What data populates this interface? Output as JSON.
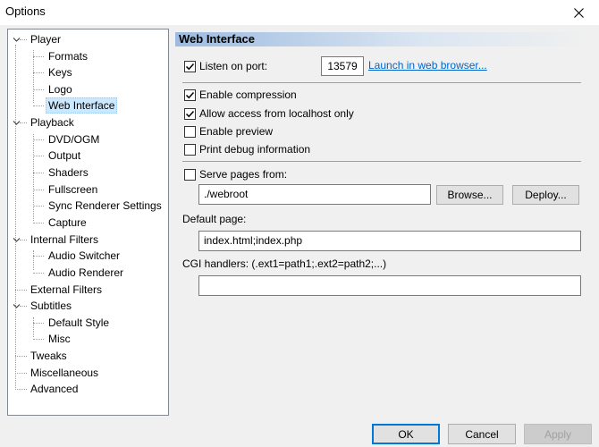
{
  "window": {
    "title": "Options"
  },
  "tree": {
    "items": [
      {
        "label": "Player"
      },
      {
        "label": "Formats"
      },
      {
        "label": "Keys"
      },
      {
        "label": "Logo"
      },
      {
        "label": "Web Interface"
      },
      {
        "label": "Playback"
      },
      {
        "label": "DVD/OGM"
      },
      {
        "label": "Output"
      },
      {
        "label": "Shaders"
      },
      {
        "label": "Fullscreen"
      },
      {
        "label": "Sync Renderer Settings"
      },
      {
        "label": "Capture"
      },
      {
        "label": "Internal Filters"
      },
      {
        "label": "Audio Switcher"
      },
      {
        "label": "Audio Renderer"
      },
      {
        "label": "External Filters"
      },
      {
        "label": "Subtitles"
      },
      {
        "label": "Default Style"
      },
      {
        "label": "Misc"
      },
      {
        "label": "Tweaks"
      },
      {
        "label": "Miscellaneous"
      },
      {
        "label": "Advanced"
      }
    ],
    "selected": "Web Interface"
  },
  "panel": {
    "header": "Web Interface",
    "listen_label": "Listen on port:",
    "listen_checked": true,
    "port_value": "13579",
    "launch_link": "Launch in web browser...",
    "enable_compression": {
      "label": "Enable compression",
      "checked": true
    },
    "allow_localhost": {
      "label": "Allow access from localhost only",
      "checked": true
    },
    "enable_preview": {
      "label": "Enable preview",
      "checked": false
    },
    "print_debug": {
      "label": "Print debug information",
      "checked": false
    },
    "serve_pages": {
      "label": "Serve pages from:",
      "checked": false
    },
    "webroot_value": "./webroot",
    "browse_label": "Browse...",
    "deploy_label": "Deploy...",
    "default_page_label": "Default page:",
    "default_page_value": "index.html;index.php",
    "cgi_label": "CGI handlers: (.ext1=path1;.ext2=path2;...)",
    "cgi_value": ""
  },
  "footer": {
    "ok_label": "OK",
    "cancel_label": "Cancel",
    "apply_label": "Apply"
  }
}
